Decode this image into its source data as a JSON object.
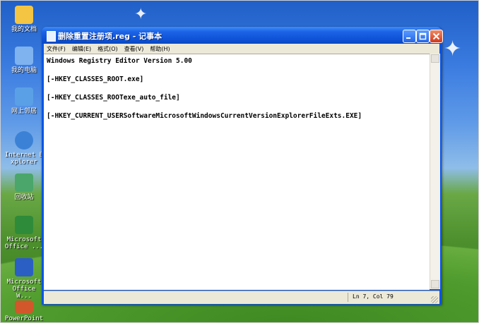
{
  "desktop": {
    "icons": [
      {
        "label": "我的文档",
        "color": "#f4c542"
      },
      {
        "label": "我的电脑",
        "color": "#7fb3f0"
      },
      {
        "label": "网上邻居",
        "color": "#5aa0e6"
      },
      {
        "label": "Internet Explorer",
        "color": "#3b82d6"
      },
      {
        "label": "回收站",
        "color": "#4aa66a"
      },
      {
        "label": "Microsoft Office ...",
        "color": "#2e8b3a"
      },
      {
        "label": "Microsoft Office W...",
        "color": "#2b5fc4"
      },
      {
        "label": "PowerPoint",
        "color": "#d2572a"
      }
    ]
  },
  "window": {
    "title": "删除重置注册项.reg - 记事本",
    "menu": [
      "文件(F)",
      "编辑(E)",
      "格式(O)",
      "查看(V)",
      "帮助(H)"
    ],
    "lines": [
      "Windows Registry Editor Version 5.00",
      "[-HKEY_CLASSES_ROOT.exe]",
      "[-HKEY_CLASSES_ROOTexe_auto_file]",
      "[-HKEY_CURRENT_USERSoftwareMicrosoftWindowsCurrentVersionExplorerFileExts.EXE]"
    ],
    "status": "Ln 7, Col 79"
  },
  "colors": {
    "titlebar": "#0a55e3",
    "close_button": "#d4381a",
    "menubar": "#ece9d8"
  }
}
